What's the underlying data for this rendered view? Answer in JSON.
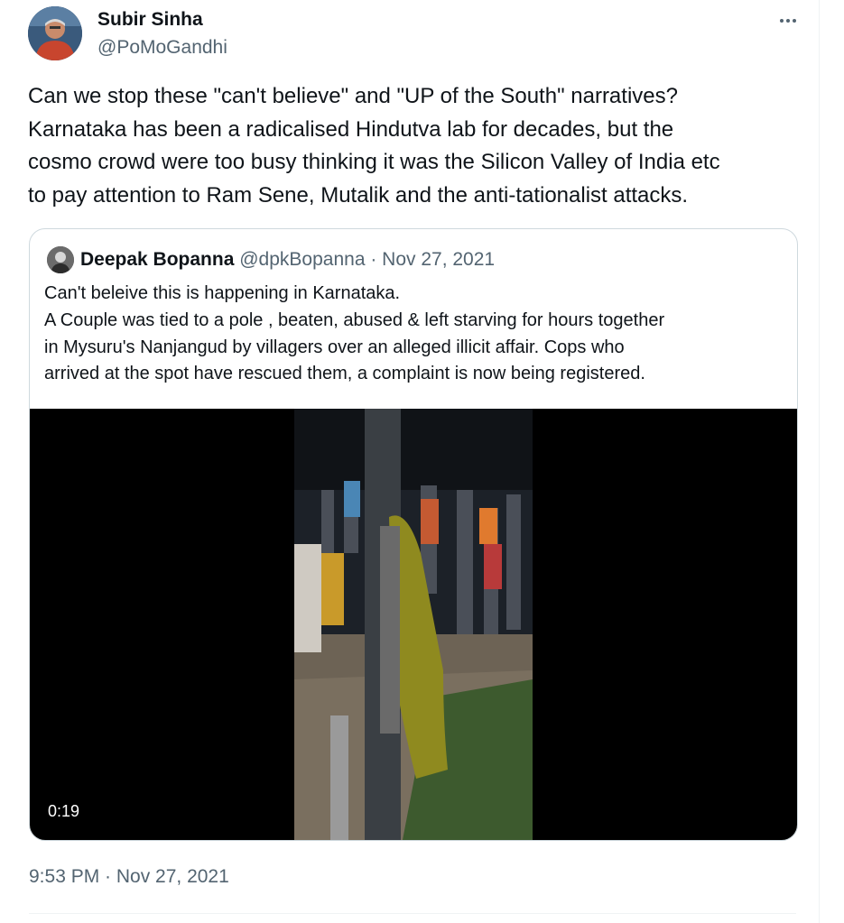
{
  "tweet": {
    "author_name": "Subir Sinha",
    "author_handle": "@PoMoGandhi",
    "more_icon": "more-horizontal-icon",
    "text": "Can we stop these \"can't believe\" and \"UP of the South\" narratives?\nKarnataka has been a radicalised Hindutva lab for decades, but the\ncosmo crowd were too busy thinking it was the Silicon Valley of India etc\nto pay attention to Ram Sene, Mutalik and the anti-tationalist attacks.",
    "timestamp": "9:53 PM · Nov 27, 2021"
  },
  "quote": {
    "author_name": "Deepak Bopanna",
    "author_handle": "@dpkBopanna",
    "separator": " · ",
    "date": "Nov 27, 2021",
    "text": "Can't beleive this is happening in Karnataka.\nA Couple was tied to a pole , beaten, abused & left starving for hours together\nin Mysuru's Nanjangud by villagers over an alleged illicit affair. Cops who\narrived at the spot have rescued them, a complaint is now being registered.",
    "video_duration": "0:19"
  }
}
